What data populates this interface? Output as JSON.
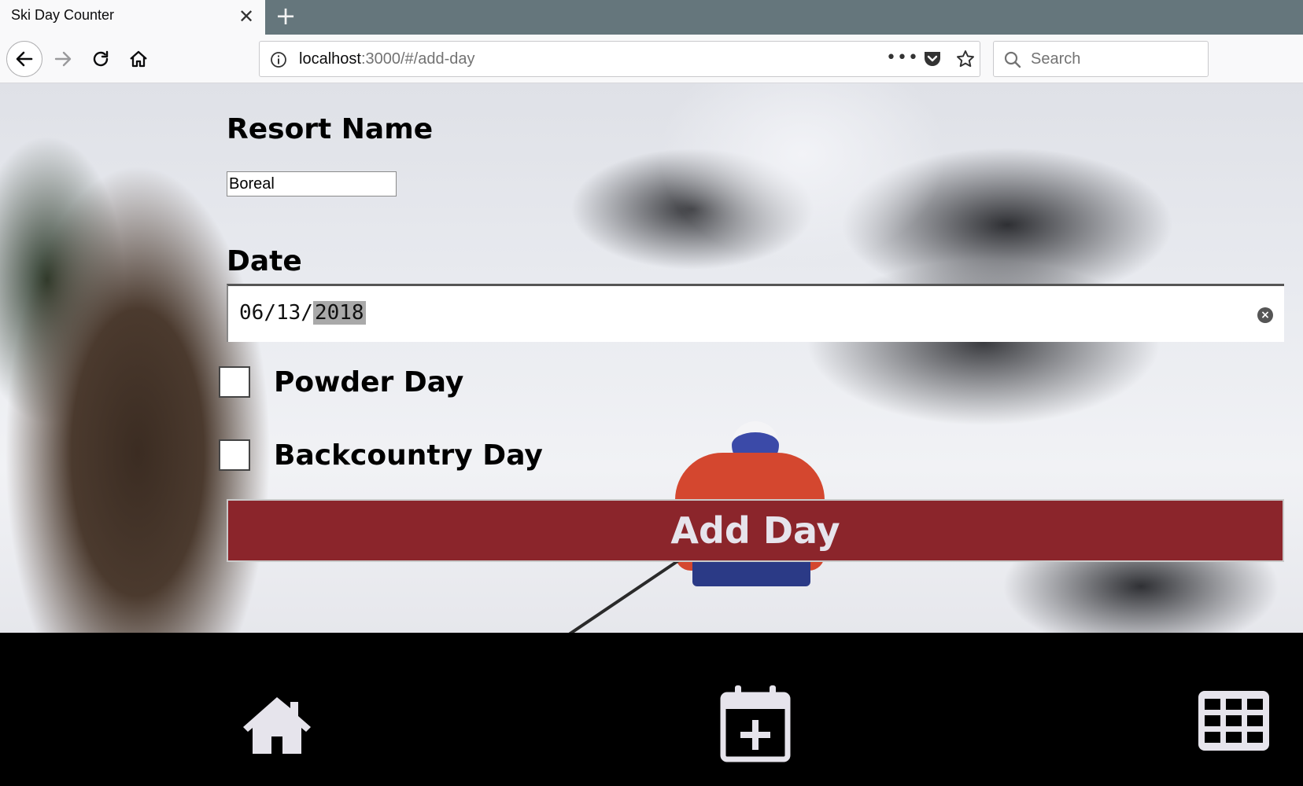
{
  "browser": {
    "tab_title": "Ski Day Counter",
    "tab_close": "✕",
    "new_tab": "+",
    "url_host": "localhost",
    "url_rest": ":3000/#/add-day",
    "url_more": "•••",
    "search_placeholder": "Search"
  },
  "form": {
    "resort_label": "Resort Name",
    "resort_value": "Boreal",
    "date_label": "Date",
    "date_month": "06",
    "date_day": "13",
    "date_year": "2018",
    "date_sep": "/",
    "powder_label": "Powder Day",
    "backcountry_label": "Backcountry Day",
    "submit_label": "Add Day"
  },
  "colors": {
    "submit_bg": "#8b252b",
    "nav_icon": "#e6e4ec",
    "bottom_bar": "#000000"
  },
  "nav": {
    "icons": [
      "home-icon",
      "calendar-plus-icon",
      "table-icon"
    ]
  }
}
